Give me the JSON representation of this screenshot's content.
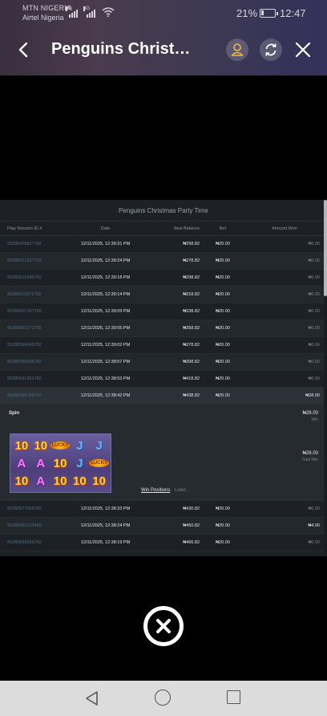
{
  "status_bar": {
    "carrier_1": "MTN NIGERIA",
    "carrier_2": "Airtel Nigeria",
    "network_1": "4G",
    "network_2": "4G",
    "battery_percent": "21%",
    "battery_level": 0.21,
    "time": "12:47"
  },
  "header": {
    "title": "Penguins Christ…"
  },
  "history": {
    "title": "Penguins Christmas Party Time",
    "columns": [
      "Play Session ID #",
      "Date",
      "New Balance",
      "Bet",
      "Amount Won"
    ],
    "rows_before": [
      {
        "id": "95285426817782",
        "date": "12/11/2025, 12:39:31 PM",
        "balance": "₦258.82",
        "bet": "₦20.00",
        "won": "₦0.00"
      },
      {
        "id": "95285621537782",
        "date": "12/11/2025, 12:39:24 PM",
        "balance": "₦278.82",
        "bet": "₦20.00",
        "won": "₦0.00"
      },
      {
        "id": "95285615390782",
        "date": "12/11/2025, 12:39:18 PM",
        "balance": "₦298.82",
        "bet": "₦20.00",
        "won": "₦0.00"
      },
      {
        "id": "95285611071782",
        "date": "12/11/2025, 12:39:14 PM",
        "balance": "₦318.82",
        "bet": "₦20.00",
        "won": "₦0.00"
      },
      {
        "id": "95285607187782",
        "date": "12/11/2025, 12:39:09 PM",
        "balance": "₦338.82",
        "bet": "₦20.00",
        "won": "₦0.00"
      },
      {
        "id": "95285603171782",
        "date": "12/11/2025, 12:39:05 PM",
        "balance": "₦358.82",
        "bet": "₦20.00",
        "won": "₦0.00"
      },
      {
        "id": "95285599645782",
        "date": "12/11/2025, 12:39:02 PM",
        "balance": "₦378.82",
        "bet": "₦20.00",
        "won": "₦0.00"
      },
      {
        "id": "95285555585782",
        "date": "12/11/2025, 12:38:57 PM",
        "balance": "₦398.82",
        "bet": "₦20.00",
        "won": "₦0.00"
      },
      {
        "id": "95285591361782",
        "date": "12/11/2025, 12:38:53 PM",
        "balance": "₦418.82",
        "bet": "₦20.00",
        "won": "₦0.00"
      },
      {
        "id": "95285586188782",
        "date": "12/11/2025, 12:38:42 PM",
        "balance": "₦438.82",
        "bet": "₦20.00",
        "won": "₦28.00"
      }
    ],
    "detail": {
      "label": "Spin",
      "win_amount": "₦28.00",
      "win_label": "Win",
      "total_win_amount": "₦28.00",
      "total_win_label": "Total Win",
      "reels": [
        [
          "10",
          "10",
          "LUCKY",
          "J",
          "J"
        ],
        [
          "A",
          "A",
          "10",
          "J",
          "LUCKY"
        ],
        [
          "10",
          "A",
          "10",
          "10",
          "10"
        ]
      ],
      "tab_win_positions": "Win Positions",
      "tab_lines": "Lines"
    },
    "rows_after": [
      {
        "id": "95285577065782",
        "date": "12/11/2025, 12:38:33 PM",
        "balance": "₦430.82",
        "bet": "₦20.00",
        "won": "₦0.00"
      },
      {
        "id": "95285563132482",
        "date": "12/11/2025, 12:38:24 PM",
        "balance": "₦450.82",
        "bet": "₦20.00",
        "won": "₦4.00"
      },
      {
        "id": "95285558255782",
        "date": "12/11/2025, 12:38:19 PM",
        "balance": "₦466.82",
        "bet": "₦20.00",
        "won": "₦0.00"
      }
    ]
  }
}
